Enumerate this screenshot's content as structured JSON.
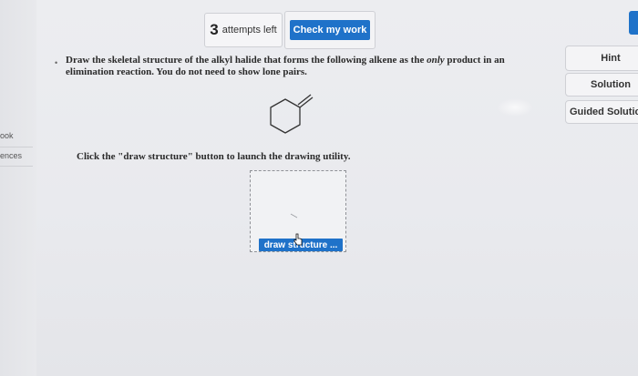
{
  "left_rail": {
    "items": [
      "ook",
      "ences"
    ]
  },
  "attempts": {
    "count": "3",
    "label": "attempts left"
  },
  "check_button": {
    "label": "Check my work"
  },
  "question": {
    "text_before": "Draw the skeletal structure of the alkyl halide that forms the following alkene as the ",
    "emphasis": "only",
    "text_after": " product in an elimination reaction. You do not need to show lone pairs."
  },
  "molecule": {
    "icon": "methylenecyclohexane-structure"
  },
  "instruction": {
    "text": "Click the \"draw structure\" button to launch the drawing utility."
  },
  "draw_button": {
    "label": "draw structure ..."
  },
  "side_panel": {
    "hint": "Hint",
    "solution": "Solution",
    "guided": "Guided Solutio"
  },
  "colors": {
    "accent_blue": "#1f72c9",
    "background": "#ebecef"
  }
}
